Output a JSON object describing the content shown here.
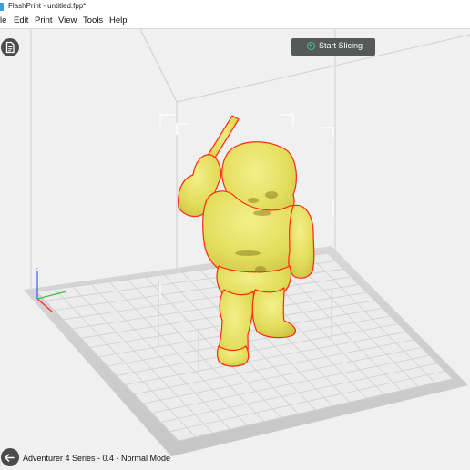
{
  "window": {
    "title": "FlashPrint - untitled.fpp*"
  },
  "menu": {
    "items": [
      "le",
      "Edit",
      "Print",
      "View",
      "Tools",
      "Help"
    ]
  },
  "toolbar": {
    "start_slicing_label": "Start Slicing",
    "file_icon": "document-icon",
    "slice_icon": "play-circle-icon"
  },
  "statusbar": {
    "machine_info": "Adventurer 4 Series - 0.4 - Normal Mode",
    "settings_icon": "printer-settings-icon"
  },
  "scene": {
    "model_color": "#e8e36a",
    "model_outline": "#ff2a0e",
    "plate_color": "#d0d0d0",
    "grid_color": "#ffffff",
    "axis_x": "#ff2a2a",
    "axis_y": "#3ac43a",
    "axis_z": "#3a5cff"
  }
}
